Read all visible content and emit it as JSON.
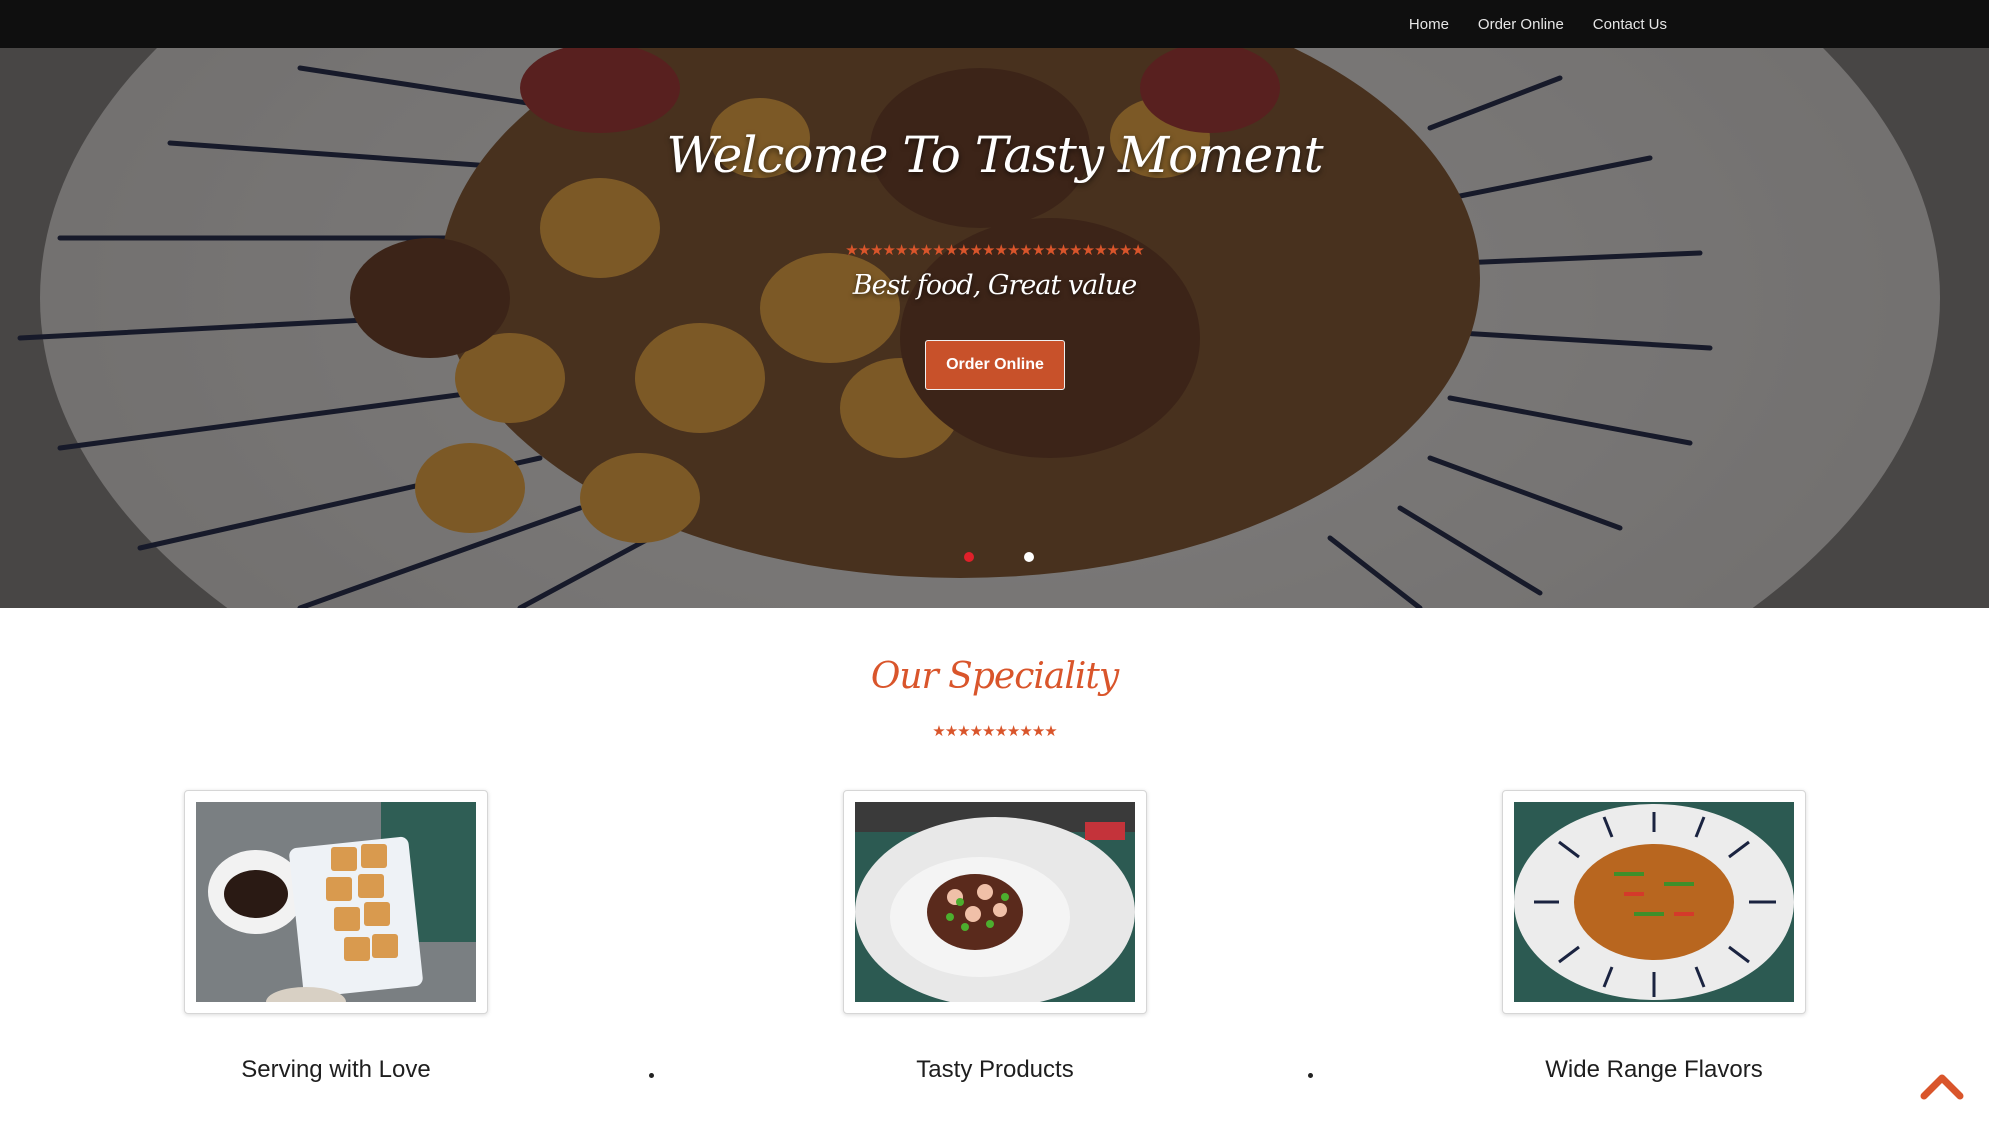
{
  "nav": {
    "items": [
      {
        "label": "Home"
      },
      {
        "label": "Order Online"
      },
      {
        "label": "Contact Us"
      }
    ]
  },
  "hero": {
    "title": "Welcome To Tasty Moment",
    "stars": "★★★★★★★★★★★★★★★★★★★★★★★★",
    "subtitle": "Best food, Great value",
    "cta_label": "Order Online",
    "slides": {
      "count": 2,
      "active_index": 0
    }
  },
  "speciality": {
    "title": "Our Speciality",
    "stars": "★★★★★★★★★★",
    "cards": [
      {
        "label": "Serving with Love"
      },
      {
        "label": "Tasty Products"
      },
      {
        "label": "Wide Range Flavors"
      }
    ]
  },
  "icons": {
    "back_to_top": "chevron-up-icon"
  },
  "colors": {
    "accent": "#d9552b",
    "button": "#c8512a",
    "nav_bg": "#0f0f0f",
    "active_dot": "#e0202a"
  }
}
